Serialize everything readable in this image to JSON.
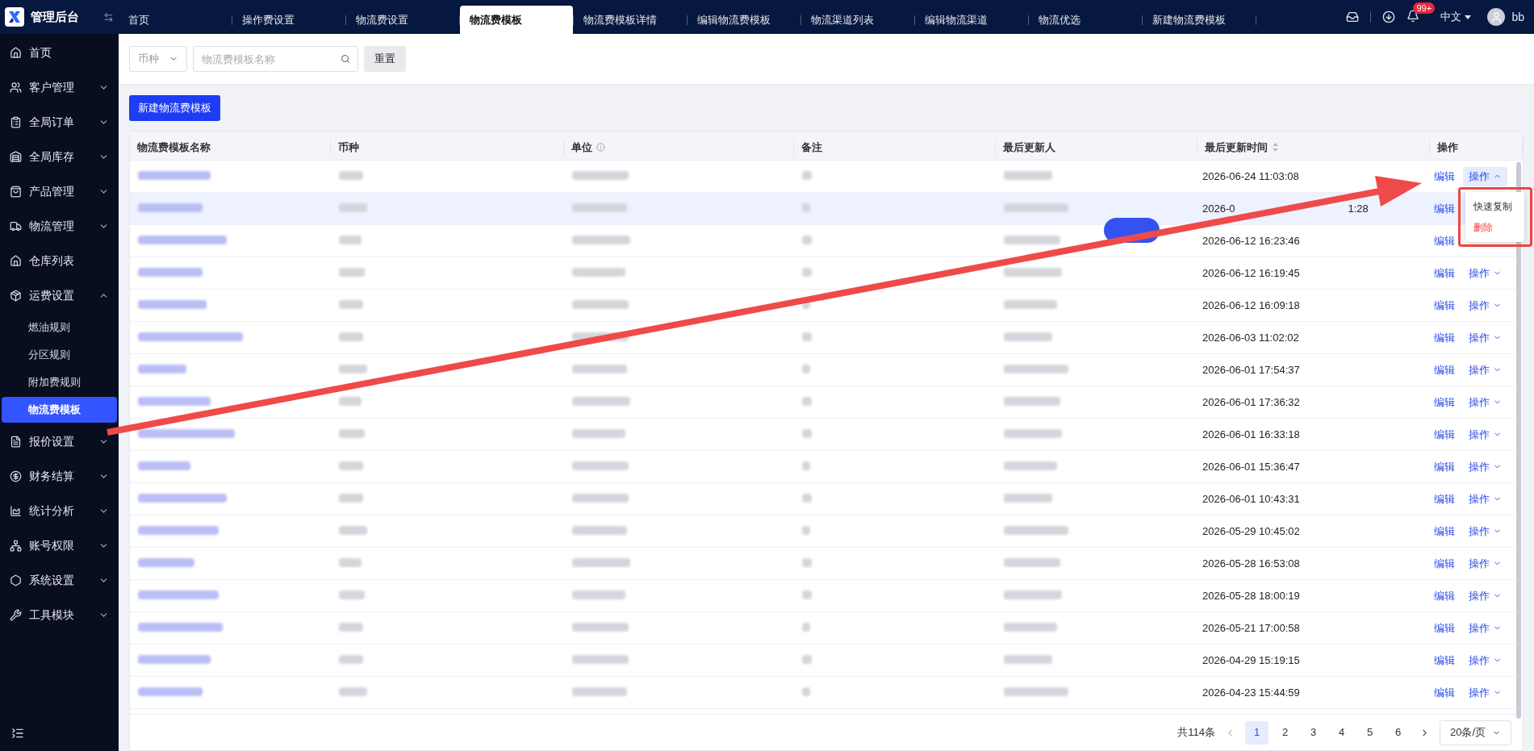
{
  "app": {
    "title": "管理后台"
  },
  "tabs": [
    {
      "label": "首页",
      "selected": false
    },
    {
      "label": "操作费设置",
      "selected": false
    },
    {
      "label": "物流费设置",
      "selected": false
    },
    {
      "label": "物流费模板",
      "selected": true
    },
    {
      "label": "物流费模板详情",
      "selected": false
    },
    {
      "label": "编辑物流费模板",
      "selected": false
    },
    {
      "label": "物流渠道列表",
      "selected": false
    },
    {
      "label": "编辑物流渠道",
      "selected": false
    },
    {
      "label": "物流优选",
      "selected": false
    },
    {
      "label": "新建物流费模板",
      "selected": false
    }
  ],
  "header": {
    "notifications": "99+",
    "language": "中文",
    "user": "bb"
  },
  "sidebar": {
    "items": [
      {
        "label": "首页"
      },
      {
        "label": "客户管理",
        "expanded": false
      },
      {
        "label": "全局订单",
        "expanded": false
      },
      {
        "label": "全局库存",
        "expanded": false
      },
      {
        "label": "产品管理",
        "expanded": false
      },
      {
        "label": "物流管理",
        "expanded": false
      },
      {
        "label": "仓库列表"
      },
      {
        "label": "运费设置",
        "expanded": true,
        "children": [
          {
            "label": "燃油规则",
            "selected": false
          },
          {
            "label": "分区规则",
            "selected": false
          },
          {
            "label": "附加费规则",
            "selected": false
          },
          {
            "label": "物流费模板",
            "selected": true
          }
        ]
      },
      {
        "label": "报价设置",
        "expanded": false
      },
      {
        "label": "财务结算",
        "expanded": false
      },
      {
        "label": "统计分析",
        "expanded": false
      },
      {
        "label": "账号权限",
        "expanded": false
      },
      {
        "label": "系统设置",
        "expanded": false
      },
      {
        "label": "工具模块",
        "expanded": false
      }
    ]
  },
  "filters": {
    "currency": {
      "placeholder": "币种"
    },
    "name": {
      "placeholder": "物流费模板名称"
    },
    "reset": "重置"
  },
  "new_button": "新建物流费模板",
  "table": {
    "columns": [
      {
        "label": "物流费模板名称",
        "kind": "plain"
      },
      {
        "label": "币种",
        "kind": "plain"
      },
      {
        "label": "单位",
        "kind": "info"
      },
      {
        "label": "备注",
        "kind": "plain"
      },
      {
        "label": "最后更新人",
        "kind": "plain"
      },
      {
        "label": "最后更新时间",
        "kind": "sort"
      },
      {
        "label": "操作",
        "kind": "plain"
      }
    ],
    "rows": [
      {
        "time": "2026-06-24 11:03:08",
        "selected": false,
        "edit": "编辑",
        "action": "操作",
        "expanded": true
      },
      {
        "time": "2026-0",
        "time_tail": "1:28",
        "selected": true,
        "edit": "编辑"
      },
      {
        "time": "2026-06-12 16:23:46",
        "selected": false,
        "edit": "编辑"
      },
      {
        "time": "2026-06-12 16:19:45",
        "selected": false,
        "edit": "编辑",
        "action": "操作",
        "expanded": false
      },
      {
        "time": "2026-06-12 16:09:18",
        "selected": false,
        "edit": "编辑",
        "action": "操作",
        "expanded": false
      },
      {
        "time": "2026-06-03 11:02:02",
        "selected": false,
        "edit": "编辑",
        "action": "操作",
        "expanded": false
      },
      {
        "time": "2026-06-01 17:54:37",
        "selected": false,
        "edit": "编辑",
        "action": "操作",
        "expanded": false
      },
      {
        "time": "2026-06-01 17:36:32",
        "selected": false,
        "edit": "编辑",
        "action": "操作",
        "expanded": false
      },
      {
        "time": "2026-06-01 16:33:18",
        "selected": false,
        "edit": "编辑",
        "action": "操作",
        "expanded": false
      },
      {
        "time": "2026-06-01 15:36:47",
        "selected": false,
        "edit": "编辑",
        "action": "操作",
        "expanded": false
      },
      {
        "time": "2026-06-01 10:43:31",
        "selected": false,
        "edit": "编辑",
        "action": "操作",
        "expanded": false
      },
      {
        "time": "2026-05-29 10:45:02",
        "selected": false,
        "edit": "编辑",
        "action": "操作",
        "expanded": false
      },
      {
        "time": "2026-05-28 16:53:08",
        "selected": false,
        "edit": "编辑",
        "action": "操作",
        "expanded": false
      },
      {
        "time": "2026-05-28 18:00:19",
        "selected": false,
        "edit": "编辑",
        "action": "操作",
        "expanded": false
      },
      {
        "time": "2026-05-21 17:00:58",
        "selected": false,
        "edit": "编辑",
        "action": "操作",
        "expanded": false
      },
      {
        "time": "2026-04-29 15:19:15",
        "selected": false,
        "edit": "编辑",
        "action": "操作",
        "expanded": false
      },
      {
        "time": "2026-04-23 15:44:59",
        "selected": false,
        "edit": "编辑",
        "action": "操作",
        "expanded": false
      }
    ]
  },
  "dropdown": {
    "items": [
      {
        "label": "快速复制",
        "kind": "normal"
      },
      {
        "label": "删除",
        "kind": "danger"
      }
    ]
  },
  "pagination": {
    "total": "共114条",
    "pages": [
      {
        "label": "1",
        "selected": true
      },
      {
        "label": "2",
        "selected": false
      },
      {
        "label": "3",
        "selected": false
      },
      {
        "label": "4",
        "selected": false
      },
      {
        "label": "5",
        "selected": false
      },
      {
        "label": "6",
        "selected": false
      }
    ],
    "page_size": "20条/页"
  }
}
